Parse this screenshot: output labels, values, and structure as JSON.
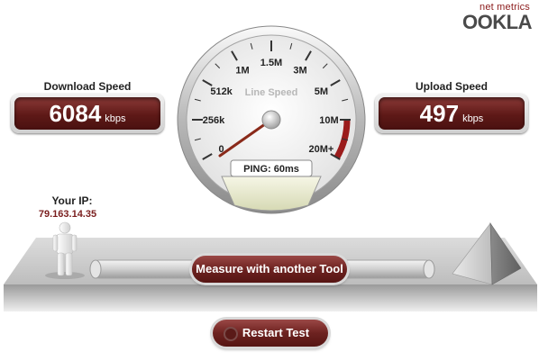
{
  "logo": {
    "tagline": "net metrics",
    "wordmark": "OOKLA"
  },
  "download": {
    "title": "Download Speed",
    "value": "6084",
    "unit": "kbps"
  },
  "upload": {
    "title": "Upload Speed",
    "value": "497",
    "unit": "kbps"
  },
  "gauge": {
    "label": "Line Speed",
    "ticks": [
      "0",
      "256k",
      "512k",
      "1M",
      "1.5M",
      "3M",
      "5M",
      "10M",
      "20M+"
    ],
    "ping_text": "PING: 60ms"
  },
  "ip": {
    "label": "Your IP:",
    "value": "79.163.14.35"
  },
  "buttons": {
    "measure": "Measure with another Tool",
    "restart": "Restart Test"
  },
  "colors": {
    "accent": "#6d2220",
    "ip_text": "#7a1e1e",
    "gauge_red": "#9b1c1c"
  }
}
